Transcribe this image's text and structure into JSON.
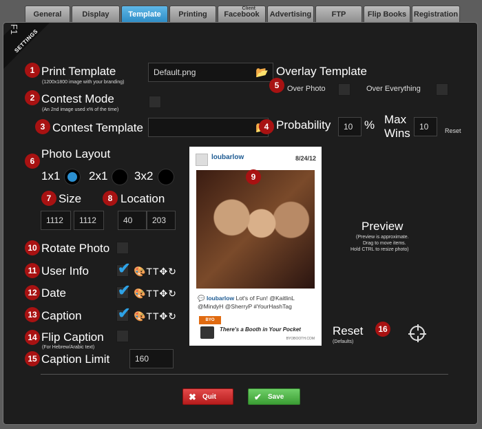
{
  "tabs": [
    {
      "label": "General"
    },
    {
      "label": "Display"
    },
    {
      "label": "Template"
    },
    {
      "label": "Printing"
    },
    {
      "label": "Facebook",
      "sup": "Client"
    },
    {
      "label": "Advertising"
    },
    {
      "label": "FTP"
    },
    {
      "label": "Flip Books"
    },
    {
      "label": "Registration"
    }
  ],
  "ribbon": {
    "key": "F1",
    "label": "SETTINGS"
  },
  "badges": [
    "1",
    "2",
    "3",
    "4",
    "5",
    "6",
    "7",
    "8",
    "9",
    "10",
    "11",
    "12",
    "13",
    "14",
    "15",
    "16"
  ],
  "print_template": {
    "label": "Print Template",
    "hint": "(1200x1800 image with your branding)",
    "value": "Default.png"
  },
  "overlay_template": {
    "label": "Overlay Template",
    "over_photo": "Over Photo",
    "over_everything": "Over Everything"
  },
  "contest_mode": {
    "label": "Contest Mode",
    "hint": "(An 2nd image used x% of the time)"
  },
  "contest_template": {
    "label": "Contest Template",
    "value": ""
  },
  "probability": {
    "label": "Probability",
    "value": "10",
    "unit": "%"
  },
  "max_wins": {
    "label_line1": "Max",
    "label_line2": "Wins",
    "value": "10",
    "reset": "Reset"
  },
  "photo_layout": {
    "label": "Photo Layout",
    "options": [
      "1x1",
      "2x1",
      "3x2"
    ],
    "selected": "1x1"
  },
  "size": {
    "label": "Size",
    "width": "1112",
    "height": "1112"
  },
  "location": {
    "label": "Location",
    "x": "40",
    "y": "203"
  },
  "rotate_photo": {
    "label": "Rotate Photo"
  },
  "user_info": {
    "label": "User Info"
  },
  "date": {
    "label": "Date"
  },
  "caption": {
    "label": "Caption"
  },
  "flip_caption": {
    "label": "Flip Caption",
    "hint": "(For Hebrew/Arabic text)"
  },
  "caption_limit": {
    "label": "Caption Limit",
    "value": "160"
  },
  "preview": {
    "title": "Preview",
    "notes": [
      "(Preview is approximate.",
      "Drag to move items.",
      "Hold CTRL to resize photo)"
    ],
    "username": "loubarlow",
    "date": "8/24/12",
    "caption_user": "loubarlow",
    "caption_text": "Lot's of Fun! @KaitlinL @MindyH @SherryP #YourHashTag",
    "logo": "BYO BOOTH",
    "slogan": "There's a Booth in Your Pocket",
    "url": "BYOBOOTH.COM"
  },
  "reset": {
    "label": "Reset",
    "hint": "(Defaults)"
  },
  "buttons": {
    "quit": "Quit",
    "save": "Save"
  },
  "colors": {
    "accent": "#2b8fd0",
    "badge": "#a81212",
    "quit": "#c62828",
    "save": "#4caf45"
  }
}
